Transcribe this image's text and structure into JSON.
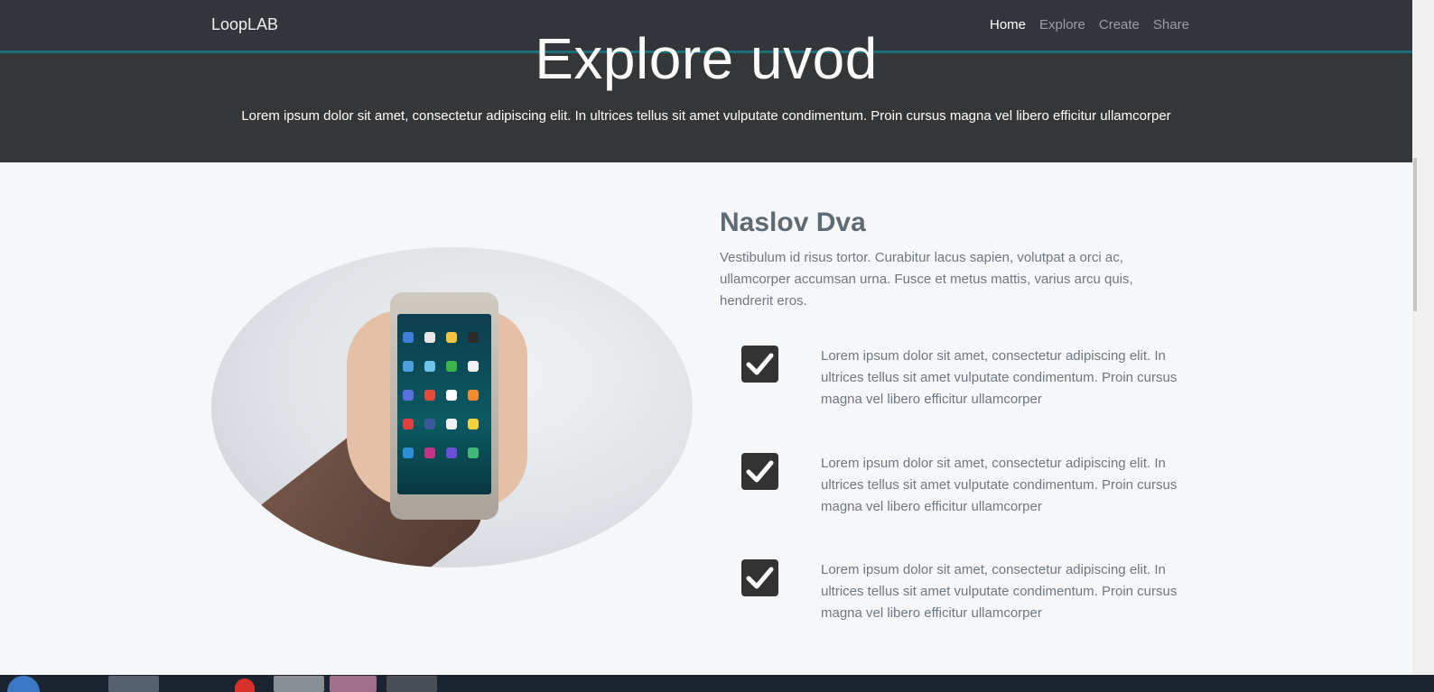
{
  "navbar": {
    "brand": "LoopLAB",
    "items": [
      {
        "label": "Home",
        "active": true
      },
      {
        "label": "Explore",
        "active": false
      },
      {
        "label": "Create",
        "active": false
      },
      {
        "label": "Share",
        "active": false
      }
    ]
  },
  "hero": {
    "title": "Explore uvod",
    "subtitle": "Lorem ipsum dolor sit amet, consectetur adipiscing elit. In ultrices tellus sit amet vulputate condimentum. Proin cursus magna vel libero efficitur ullamcorper"
  },
  "section": {
    "title": "Naslov Dva",
    "description": "Vestibulum id risus tortor. Curabitur lacus sapien, volutpat a orci ac, ullamcorper accumsan urna. Fusce et metus mattis, varius arcu quis, hendrerit eros.",
    "features": [
      {
        "icon": "checkbox-checked-icon",
        "text": "Lorem ipsum dolor sit amet, consectetur adipiscing elit. In ultrices tellus sit amet vulputate condimentum. Proin cursus magna vel libero efficitur ullamcorper"
      },
      {
        "icon": "checkbox-checked-icon",
        "text": "Lorem ipsum dolor sit amet, consectetur adipiscing elit. In ultrices tellus sit amet vulputate condimentum. Proin cursus magna vel libero efficitur ullamcorper"
      },
      {
        "icon": "checkbox-checked-icon",
        "text": "Lorem ipsum dolor sit amet, consectetur adipiscing elit. In ultrices tellus sit amet vulputate condimentum. Proin cursus magna vel libero efficitur ullamcorper"
      }
    ]
  },
  "colors": {
    "navbar_bg": "#32363a",
    "accent_line": "#1c6f78",
    "hero_bg": "#343638",
    "page_bg": "#f5f7f9",
    "check_bg": "#333333"
  }
}
